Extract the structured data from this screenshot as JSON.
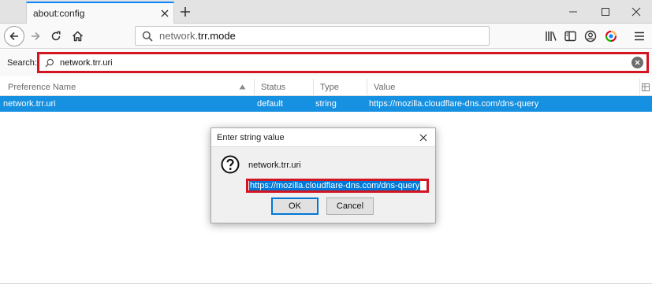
{
  "tab": {
    "title": "about:config"
  },
  "url": {
    "prefix": "network.",
    "strong": "trr.mode"
  },
  "search": {
    "label": "Search:",
    "value": "network.trr.uri"
  },
  "table": {
    "columns": [
      "Preference Name",
      "Status",
      "Type",
      "Value"
    ],
    "selected_row": {
      "name": "network.trr.uri",
      "status": "default",
      "type": "string",
      "value": "https://mozilla.cloudflare-dns.com/dns-query"
    }
  },
  "dialog": {
    "title": "Enter string value",
    "message": "network.trr.uri",
    "input_value": "https://mozilla.cloudflare-dns.com/dns-query",
    "ok_label": "OK",
    "cancel_label": "Cancel"
  },
  "colors": {
    "accent": "#0a84ff",
    "selection": "#1690e0",
    "highlight_box": "#d31421"
  }
}
